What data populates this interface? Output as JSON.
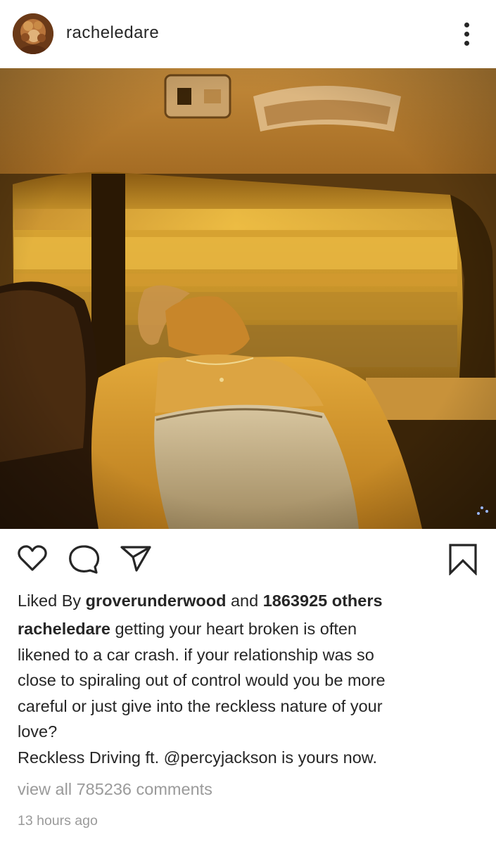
{
  "post": {
    "username": "racheledare",
    "avatar_icon": "profile-avatar",
    "more_icon": "more-options-icon",
    "photo_alt": "photo"
  },
  "actions": {
    "icons": [
      "heart-icon",
      "comment-icon",
      "share-icon",
      "bookmark-icon"
    ]
  },
  "likes": {
    "prefix": "Liked By ",
    "liked_by_user": "groverunderwood",
    "middle": " and ",
    "others": "1863925 others"
  },
  "caption": {
    "username": "racheledare",
    "line1": " getting your heart broken is often",
    "line2": "likened to a car crash. if your relationship was so",
    "line3": "close to spiraling out of control would you be more",
    "line4": "careful or just give into the reckless nature of your",
    "line5": "love?",
    "line6": "Reckless Driving ft. @percyjackson is yours now."
  },
  "comments": {
    "view_all": "view all 785236 comments"
  },
  "timestamp": "13 hours ago",
  "colors": {
    "text": "#262626",
    "muted": "#9a9a9a",
    "photo_warm": "#d9a030"
  }
}
